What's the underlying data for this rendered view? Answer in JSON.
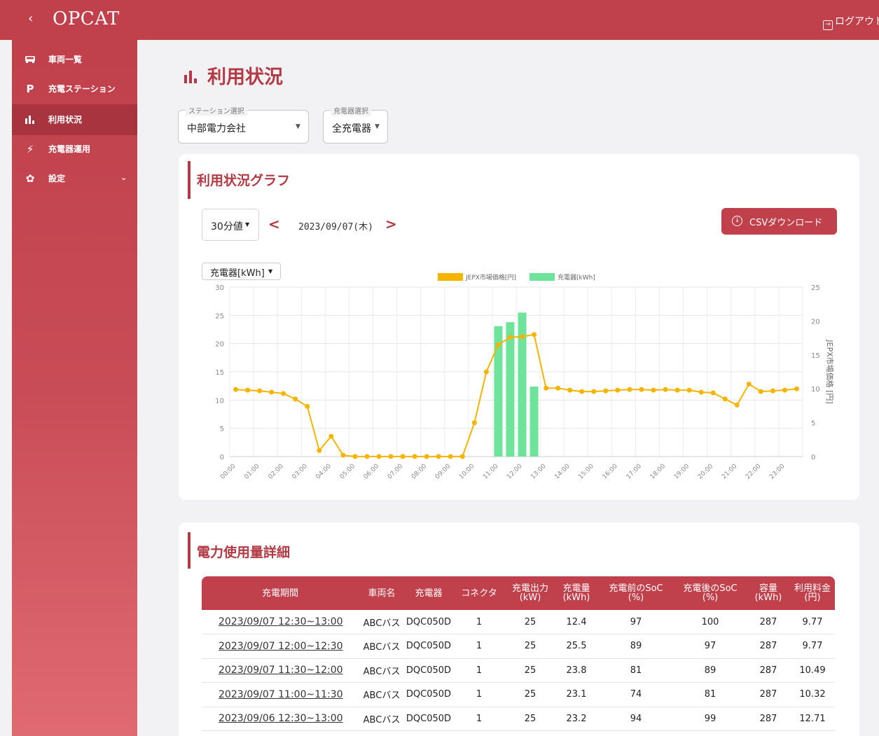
{
  "header": {
    "back_glyph": "‹",
    "logo": "OPCAT",
    "logout_label": "ログアウト"
  },
  "sidebar": {
    "items": [
      {
        "label": "車両一覧",
        "icon": "car-icon",
        "glyph": "▭"
      },
      {
        "label": "充電ステーション",
        "icon": "parking-icon",
        "glyph": "P"
      },
      {
        "label": "利用状況",
        "icon": "bar-chart-icon",
        "glyph": "ıl",
        "active": true
      },
      {
        "label": "充電器運用",
        "icon": "charger-icon",
        "glyph": "⚡"
      },
      {
        "label": "設定",
        "icon": "gear-icon",
        "glyph": "✿"
      }
    ]
  },
  "page": {
    "title": "利用状況",
    "title_icon": "ıl"
  },
  "filters": {
    "station_legend": "ステーション選択",
    "station_value": "中部電力会社",
    "charger_legend": "充電器選択",
    "charger_value": "全充電器"
  },
  "graph_card": {
    "title": "利用状況グラフ",
    "interval": "30分値",
    "date": "2023/09/07(木)",
    "prev": "<",
    "next": ">",
    "csv_label": "CSVダウンロード",
    "metric_select": "充電器[kWh]"
  },
  "chart_data": {
    "type": "bar+line",
    "legend": [
      "JEPX市場価格[円]",
      "充電器[kWh]"
    ],
    "legend_position": "top-center",
    "grid": true,
    "x": [
      "00:00",
      "00:30",
      "01:00",
      "01:30",
      "02:00",
      "02:30",
      "03:00",
      "03:30",
      "04:00",
      "04:30",
      "05:00",
      "05:30",
      "06:00",
      "06:30",
      "07:00",
      "07:30",
      "08:00",
      "08:30",
      "09:00",
      "09:30",
      "10:00",
      "10:30",
      "11:00",
      "11:30",
      "12:00",
      "12:30",
      "13:00",
      "13:30",
      "14:00",
      "14:30",
      "15:00",
      "15:30",
      "16:00",
      "16:30",
      "17:00",
      "17:30",
      "18:00",
      "18:30",
      "19:00",
      "19:30",
      "20:00",
      "20:30",
      "21:00",
      "21:30",
      "22:00",
      "22:30",
      "23:00",
      "23:30"
    ],
    "x_tick_labels": [
      "00:00",
      "01:00",
      "02:00",
      "03:00",
      "04:00",
      "05:00",
      "06:00",
      "07:00",
      "08:00",
      "09:00",
      "10:00",
      "11:00",
      "12:00",
      "13:00",
      "14:00",
      "15:00",
      "16:00",
      "17:00",
      "18:00",
      "19:00",
      "20:00",
      "21:00",
      "22:00",
      "23:00"
    ],
    "y_left": {
      "label": "",
      "range": [
        0,
        30
      ],
      "ticks": [
        0,
        5,
        10,
        15,
        20,
        25,
        30
      ]
    },
    "y_right": {
      "label": "JEPX市場価格 [円]",
      "range": [
        0,
        25
      ],
      "ticks": [
        0,
        5,
        10,
        15,
        20,
        25
      ]
    },
    "series": [
      {
        "name": "充電器[kWh]",
        "type": "bar",
        "axis": "left",
        "color": "#6ee39a",
        "values": [
          0,
          0,
          0,
          0,
          0,
          0,
          0,
          0,
          0,
          0,
          0,
          0,
          0,
          0,
          0,
          0,
          0,
          0,
          0,
          0,
          0,
          0,
          23.1,
          23.8,
          25.5,
          12.4,
          0,
          0,
          0,
          0,
          0,
          0,
          0,
          0,
          0,
          0,
          0,
          0,
          0,
          0,
          0,
          0,
          0,
          0,
          0,
          0,
          0,
          0
        ]
      },
      {
        "name": "JEPX市場価格[円]",
        "type": "line",
        "axis": "right",
        "color": "#f5b400",
        "values": [
          9.9,
          9.8,
          9.7,
          9.5,
          9.3,
          8.5,
          7.4,
          0.9,
          3.0,
          0.2,
          0.01,
          0.01,
          0.01,
          0.01,
          0.01,
          0.01,
          0.01,
          0.01,
          0.01,
          0.01,
          5.0,
          12.5,
          16.5,
          17.6,
          17.7,
          18.0,
          10.1,
          10.1,
          9.8,
          9.6,
          9.6,
          9.7,
          9.8,
          9.9,
          9.9,
          9.8,
          9.9,
          9.8,
          9.8,
          9.5,
          9.4,
          8.5,
          7.6,
          10.7,
          9.6,
          9.7,
          9.8,
          10.0
        ]
      }
    ]
  },
  "detail_card": {
    "title": "電力使用量詳細",
    "columns": [
      [
        "充電期間"
      ],
      [
        "車両名"
      ],
      [
        "充電器"
      ],
      [
        "コネクタ"
      ],
      [
        "充電出力",
        "(kW)"
      ],
      [
        "充電量",
        "(kWh)"
      ],
      [
        "充電前のSoC",
        "(%)"
      ],
      [
        "充電後のSoC",
        "(%)"
      ],
      [
        "容量",
        "(kWh)"
      ],
      [
        "利用料金",
        "(円)"
      ]
    ],
    "rows": [
      [
        "2023/09/07 12:30~13:00",
        "ABCバス",
        "DQC050D",
        "1",
        "25",
        "12.4",
        "97",
        "100",
        "287",
        "9.77"
      ],
      [
        "2023/09/07 12:00~12:30",
        "ABCバス",
        "DQC050D",
        "1",
        "25",
        "25.5",
        "89",
        "97",
        "287",
        "9.77"
      ],
      [
        "2023/09/07 11:30~12:00",
        "ABCバス",
        "DQC050D",
        "1",
        "25",
        "23.8",
        "81",
        "89",
        "287",
        "10.49"
      ],
      [
        "2023/09/07 11:00~11:30",
        "ABCバス",
        "DQC050D",
        "1",
        "25",
        "23.1",
        "74",
        "81",
        "287",
        "10.32"
      ],
      [
        "2023/09/06 12:30~13:00",
        "ABCバス",
        "DQC050D",
        "1",
        "25",
        "23.2",
        "94",
        "99",
        "287",
        "12.71"
      ]
    ]
  }
}
